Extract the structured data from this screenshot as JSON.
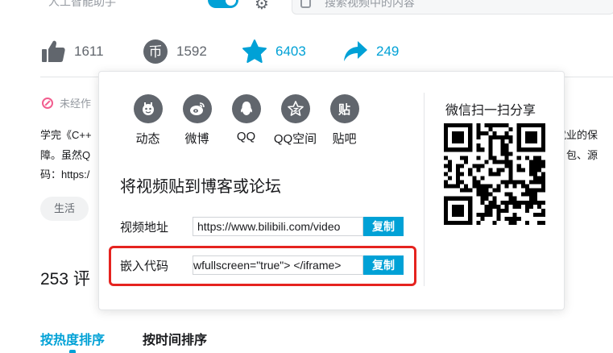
{
  "topbar": {
    "cut_text": "人工智能助手",
    "search_placeholder": "搜索视频中的内容"
  },
  "actions": {
    "like_count": "1611",
    "coin_count": "1592",
    "coin_glyph": "币",
    "favorite_count": "6403",
    "share_count": "249"
  },
  "description": {
    "notice": "未经作",
    "line1": "学完《C++",
    "line1_right": "就业的保",
    "line2": "障。虽然Q",
    "line2_right": "包、源",
    "line3": "码：https:/",
    "tag": "生活"
  },
  "comments": {
    "count_label": "253  评",
    "sort_hot": "按热度排序",
    "sort_time": "按时间排序"
  },
  "share_popup": {
    "targets": [
      {
        "label": "动态",
        "glyph": "◆"
      },
      {
        "label": "微博",
        "glyph": "◉"
      },
      {
        "label": "QQ",
        "glyph": "●"
      },
      {
        "label": "QQ空间",
        "glyph": "★"
      },
      {
        "label": "贴吧",
        "glyph": "贴"
      }
    ],
    "embed_title": "将视频贴到博客或论坛",
    "video_url_label": "视频地址",
    "video_url_value": "https://www.bilibili.com/video",
    "embed_code_label": "嵌入代码",
    "embed_code_value": "wfullscreen=\"true\"> </iframe>",
    "copy_label": "复制",
    "qr_title": "微信扫一扫分享"
  },
  "colors": {
    "accent": "#00a1d6",
    "highlight_border": "#e5231f",
    "icon_grey": "#61666d"
  }
}
